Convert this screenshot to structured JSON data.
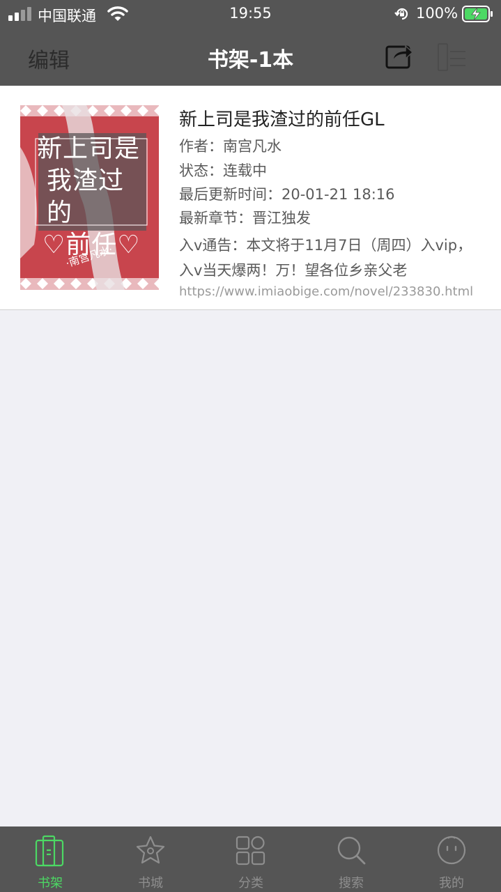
{
  "status_bar": {
    "carrier": "中国联通",
    "time": "19:55",
    "battery_percent": "100%"
  },
  "nav": {
    "edit_label": "编辑",
    "title": "书架-1本",
    "share_icon": "share-icon",
    "menu_icon": "menu-icon"
  },
  "book": {
    "cover_title_lines": [
      "新上司是",
      "我渣过的",
      "♡前任♡"
    ],
    "cover_author": "·南宫凡水·",
    "title": "新上司是我渣过的前任GL",
    "author": "作者：南宫凡水",
    "status": "状态：连载中",
    "updated": "最后更新时间：20-01-21 18:16",
    "latest_chapter": "最新章节：晋江独发",
    "notice": "入ⅴ通告：本文将于11月7日（周四）入vip，入ⅴ当天爆两！万！望各位乡亲父老",
    "url": "https://www.imiaobige.com/novel/233830.html"
  },
  "tabs": [
    {
      "label": "书架",
      "icon": "bookshelf-icon",
      "active": true
    },
    {
      "label": "书城",
      "icon": "star-icon",
      "active": false
    },
    {
      "label": "分类",
      "icon": "category-grid-icon",
      "active": false
    },
    {
      "label": "搜索",
      "icon": "search-icon",
      "active": false
    },
    {
      "label": "我的",
      "icon": "profile-face-icon",
      "active": false
    }
  ],
  "colors": {
    "bar_background": "#555555",
    "active_tab": "#4cd964",
    "inactive_tab": "#8e8e8e",
    "page_background": "#f0f0f5"
  }
}
